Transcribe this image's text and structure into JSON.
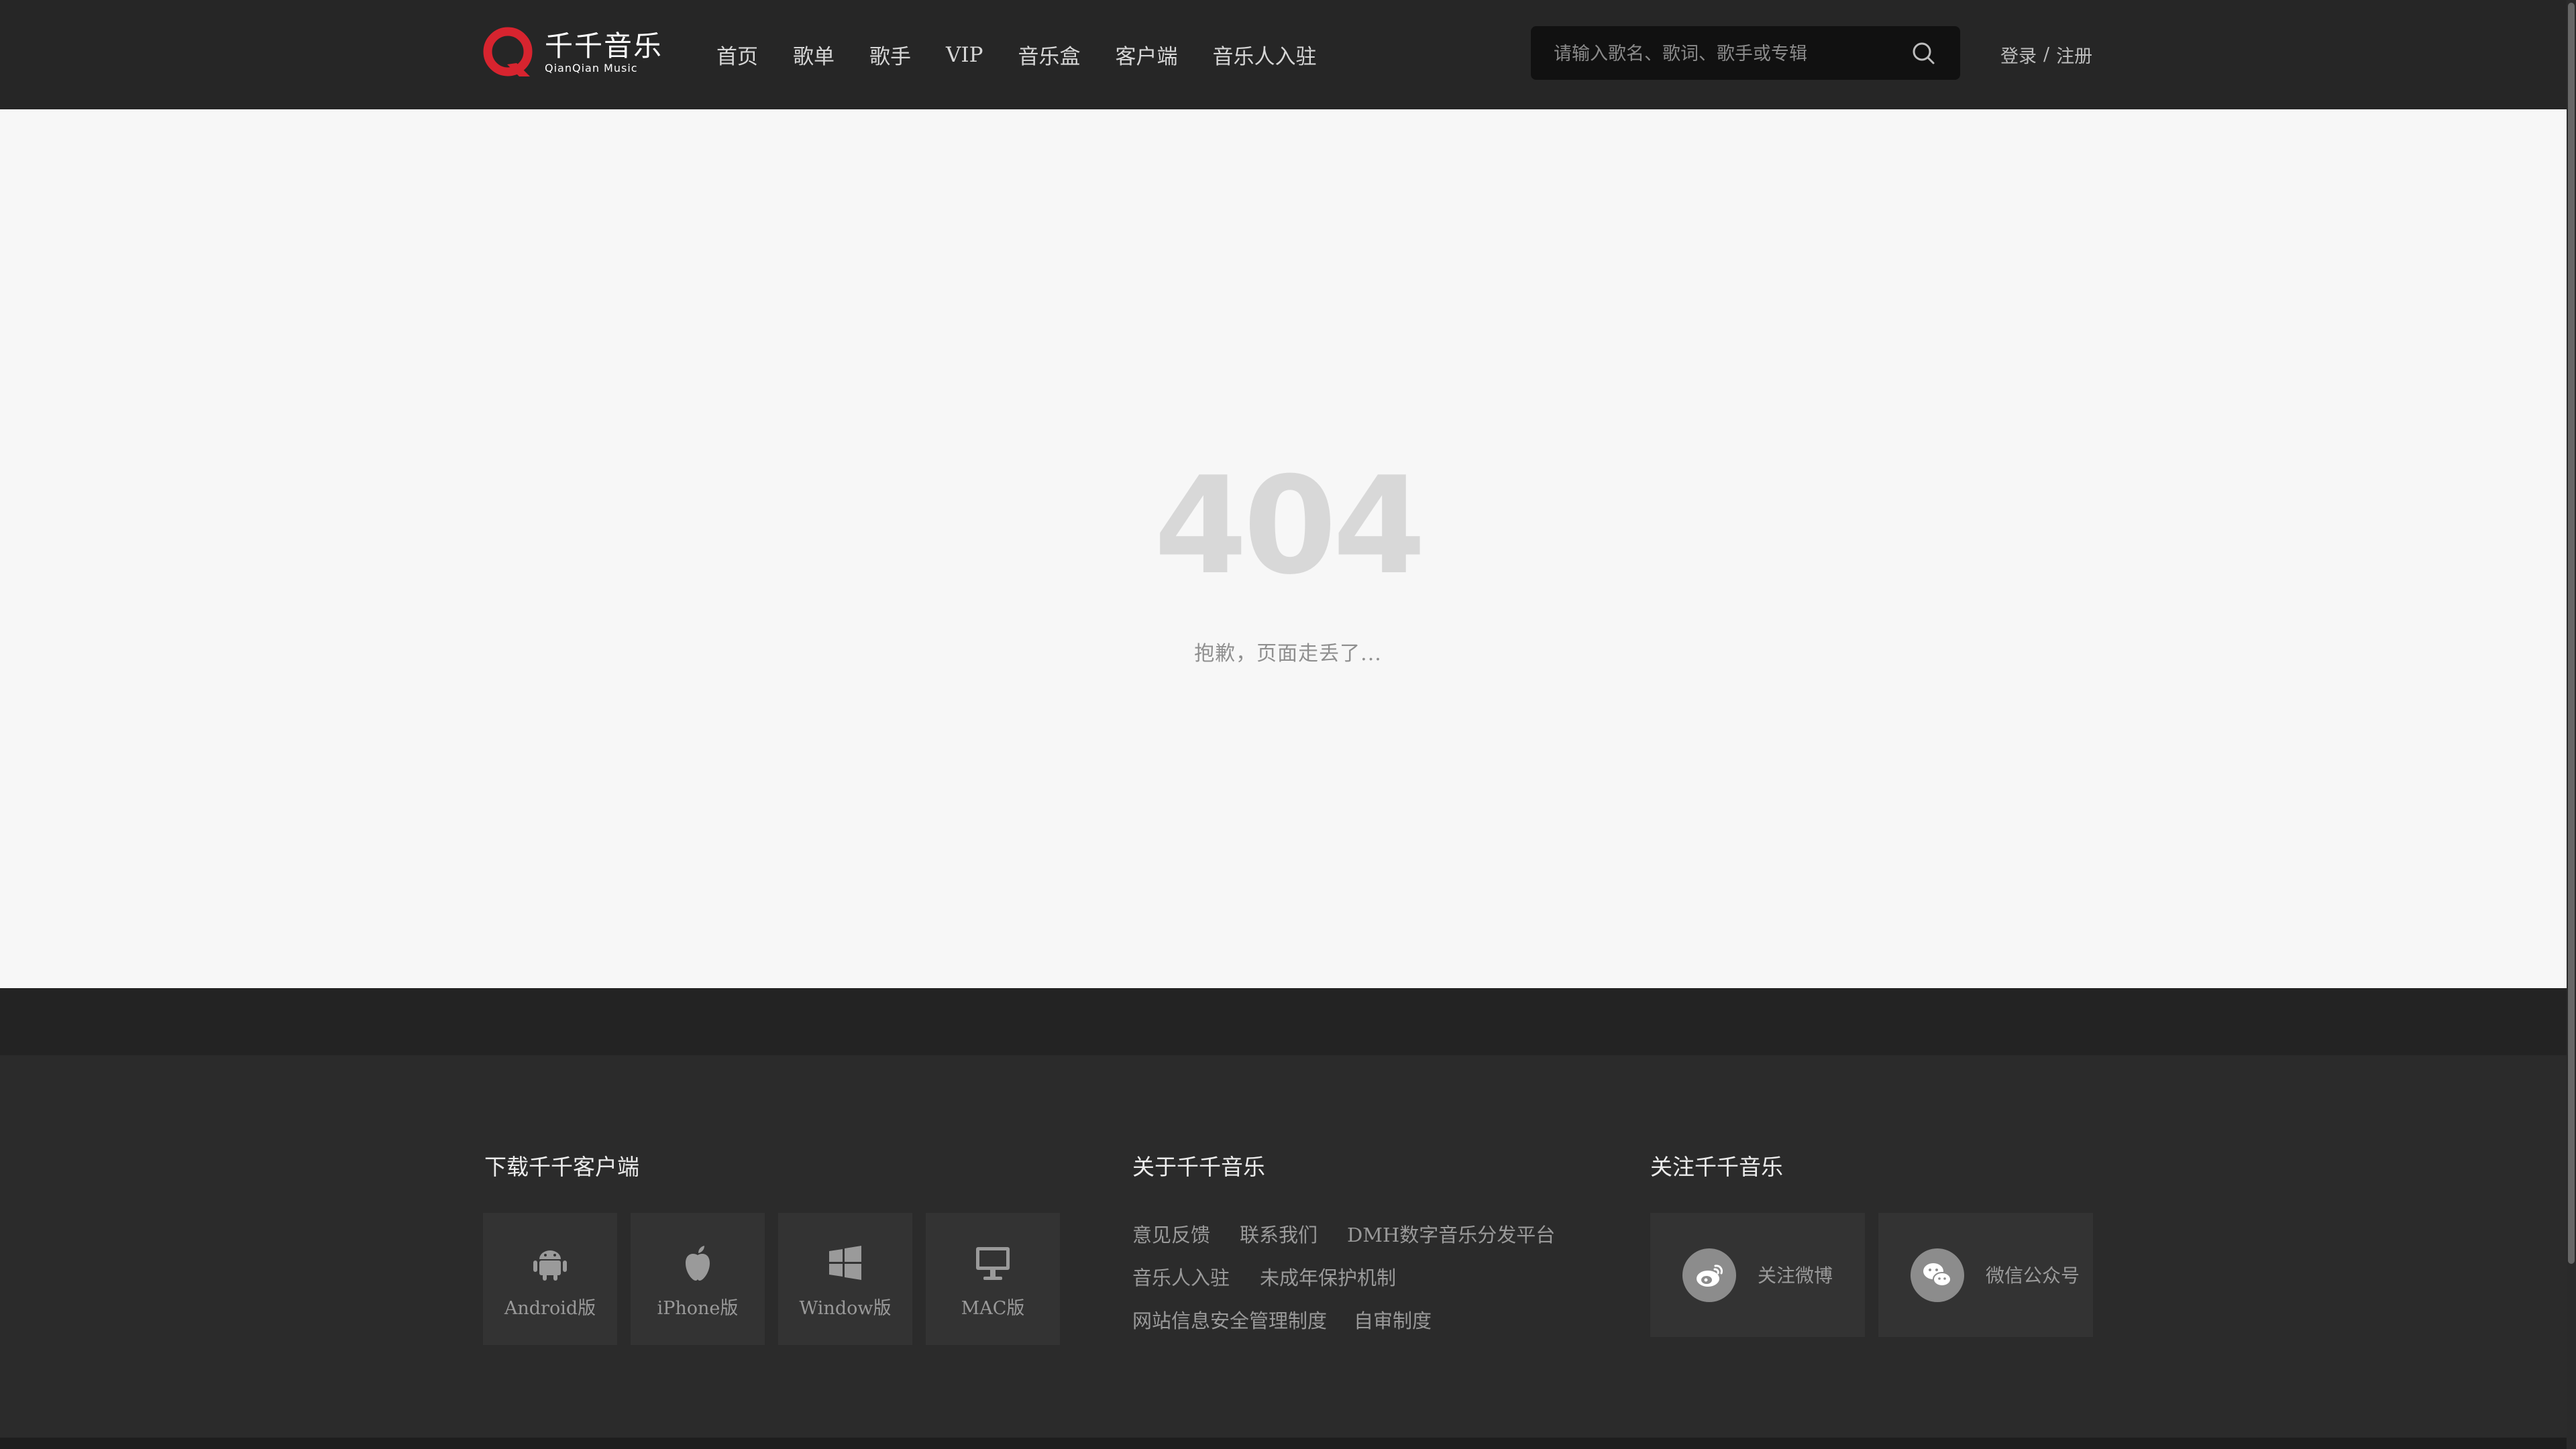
{
  "header": {
    "logo": {
      "cn": "千千音乐",
      "en": "QianQian Music"
    },
    "nav": [
      "首页",
      "歌单",
      "歌手",
      "VIP",
      "音乐盒",
      "客户端",
      "音乐人入驻"
    ],
    "search": {
      "placeholder": "请输入歌名、歌词、歌手或专辑",
      "value": ""
    },
    "auth": {
      "login": "登录",
      "separator": "/",
      "register": "注册"
    }
  },
  "main": {
    "error_code": "404",
    "message": "抱歉，页面走丢了..."
  },
  "footer": {
    "download": {
      "title": "下载千千客户端",
      "items": [
        {
          "label": "Android版",
          "icon": "android-icon"
        },
        {
          "label": "iPhone版",
          "icon": "apple-icon"
        },
        {
          "label": "Window版",
          "icon": "windows-icon"
        },
        {
          "label": "MAC版",
          "icon": "monitor-icon"
        }
      ]
    },
    "about": {
      "title": "关于千千音乐",
      "links": [
        "意见反馈",
        "联系我们",
        "DMH数字音乐分发平台",
        "音乐人入驻",
        "未成年保护机制",
        "网站信息安全管理制度",
        "自审制度"
      ]
    },
    "follow": {
      "title": "关注千千音乐",
      "items": [
        {
          "label": "关注微博",
          "icon": "weibo-icon"
        },
        {
          "label": "微信公众号",
          "icon": "wechat-icon"
        }
      ]
    }
  },
  "colors": {
    "header_bg": "#262626",
    "brand_red": "#d7242f",
    "page_bg": "#f7f7f7",
    "footer_bg": "#2b2b2b"
  }
}
